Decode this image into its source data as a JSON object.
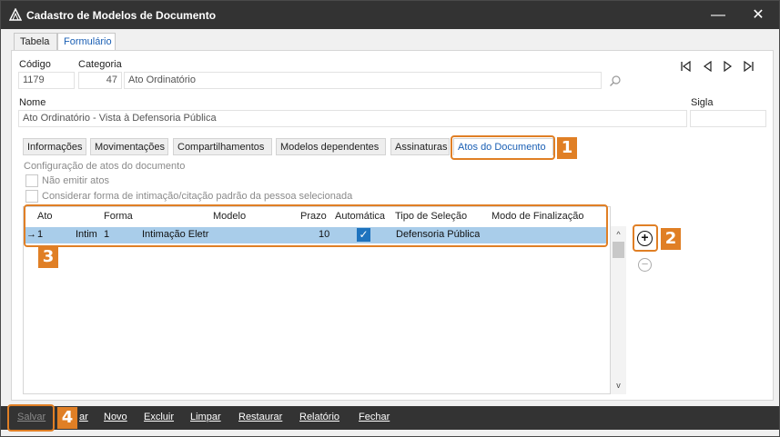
{
  "window": {
    "title": "Cadastro de Modelos de Documento",
    "minimize_glyph": "—",
    "close_glyph": "✕",
    "icon": "app-logo-icon"
  },
  "top_tabs": [
    {
      "label": "Tabela",
      "active": false
    },
    {
      "label": "Formulário",
      "active": true
    }
  ],
  "form": {
    "codigo_label": "Código",
    "codigo_value": "1179",
    "categoria_label": "Categoria",
    "categoria_code": "47",
    "categoria_desc": "Ato Ordinatório",
    "nome_label": "Nome",
    "nome_value": "Ato Ordinatório - Vista à Defensoria Pública",
    "sigla_label": "Sigla",
    "sigla_value": ""
  },
  "record_nav": {
    "first": "⏮",
    "prev": "◁",
    "next": "▷",
    "last": "⏭"
  },
  "sub_tabs": [
    {
      "label": "Informações",
      "active": false
    },
    {
      "label": "Movimentações",
      "active": false
    },
    {
      "label": "Compartilhamentos",
      "active": false
    },
    {
      "label": "Modelos dependentes",
      "active": false
    },
    {
      "label": "Assinaturas",
      "active": false
    },
    {
      "label": "Atos do Documento",
      "active": true
    }
  ],
  "atos": {
    "section_title": "Configuração de atos do documento",
    "options": [
      {
        "label": "Não emitir atos",
        "checked": false
      },
      {
        "label": "Considerar forma de intimação/citação padrão da pessoa selecionada",
        "checked": false
      }
    ],
    "grid": {
      "columns": [
        "Ato",
        "Forma",
        "Modelo",
        "Prazo",
        "Automática",
        "Tipo de Seleção",
        "Modo de Finalização"
      ],
      "rows": [
        {
          "indicator": "→",
          "ato": "1",
          "forma_code": "Intim",
          "forma": "1",
          "modelo": "Intimação Eletr",
          "prazo": "10",
          "automatica": "✓",
          "tipo_selecao": "Defensoria Pública",
          "modo_finalizacao": ""
        }
      ]
    },
    "add_glyph": "+",
    "remove_glyph": "−",
    "scroll_up": "^",
    "scroll_down": "v"
  },
  "callouts": [
    "1",
    "2",
    "3",
    "4"
  ],
  "bottom_buttons": [
    {
      "label": "Salvar",
      "enabled": false
    },
    {
      "label": "ar",
      "enabled": true
    },
    {
      "label": "Novo",
      "enabled": true
    },
    {
      "label": "Excluir",
      "enabled": true
    },
    {
      "label": "Limpar",
      "enabled": true
    },
    {
      "label": "Restaurar",
      "enabled": true
    },
    {
      "label": "Relatório",
      "enabled": true
    },
    {
      "label": "Fechar",
      "enabled": true
    }
  ],
  "colors": {
    "titlebar": "#333333",
    "accent": "#1a5fb4",
    "callout": "#e07f25",
    "row_selected": "#a9cdea",
    "checkbox_checked": "#1e73be"
  }
}
